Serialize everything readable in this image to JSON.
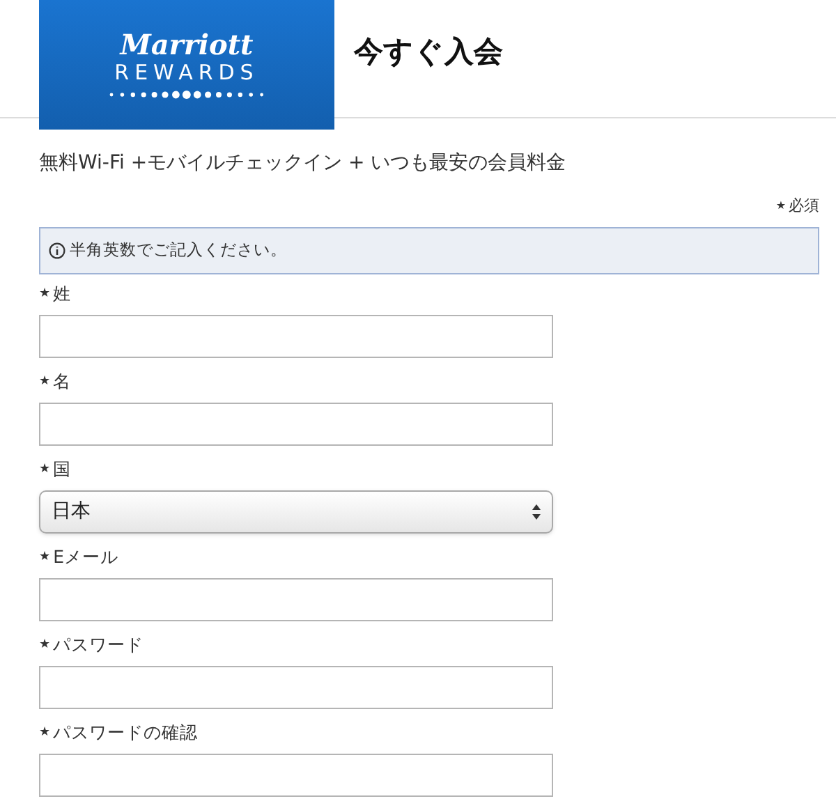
{
  "logo": {
    "brand": "Marriott",
    "program": "REWARDS"
  },
  "title": "今すぐ入会",
  "tagline": "無料Wi-Fi +モバイルチェックイン + いつも最安の会員料金",
  "required_mark": "★",
  "required_legend": "必須",
  "notice": "半角英数でご記入ください。",
  "fields": [
    {
      "label": "姓",
      "kind": "text",
      "required": true
    },
    {
      "label": "名",
      "kind": "text",
      "required": true
    },
    {
      "label": "国",
      "kind": "select",
      "required": true,
      "value": "日本"
    },
    {
      "label": "Eメール",
      "kind": "text",
      "required": true
    },
    {
      "label": "パスワード",
      "kind": "text",
      "required": true
    },
    {
      "label": "パスワードの確認",
      "kind": "text",
      "required": true
    }
  ]
}
